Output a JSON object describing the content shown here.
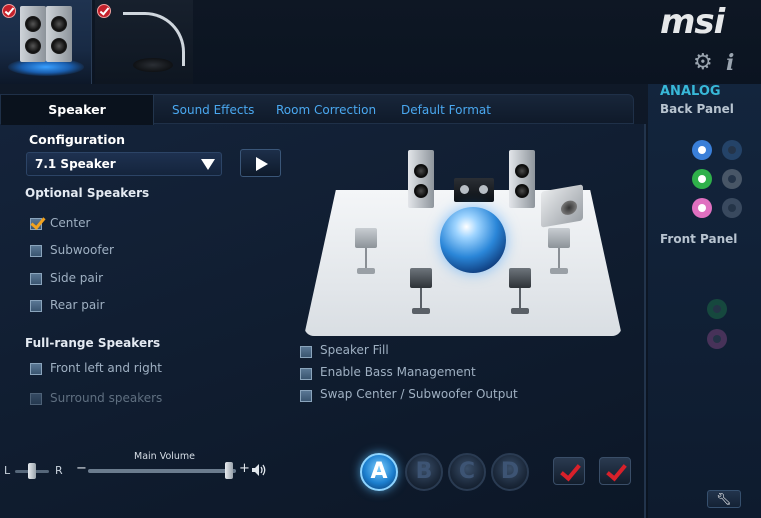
{
  "brand": {
    "logo_text": "msi"
  },
  "header": {
    "devices": [
      {
        "name": "Speakers",
        "icon": "speakers-icon",
        "selected": true,
        "enabled": true
      },
      {
        "name": "Microphone",
        "icon": "microphone-icon",
        "selected": false,
        "enabled": true
      }
    ],
    "settings_icon": "gear-icon",
    "info_icon": "info-icon",
    "info_glyph": "i"
  },
  "tabs": [
    {
      "label": "Speaker Configuration",
      "active": true
    },
    {
      "label": "Sound Effects",
      "active": false
    },
    {
      "label": "Room Correction",
      "active": false
    },
    {
      "label": "Default Format",
      "active": false
    }
  ],
  "config": {
    "selected": "7.1 Speaker"
  },
  "optional_speakers": {
    "title": "Optional Speakers",
    "items": [
      {
        "label": "Center",
        "checked": true,
        "enabled": true
      },
      {
        "label": "Subwoofer",
        "checked": false,
        "enabled": true
      },
      {
        "label": "Side pair",
        "checked": false,
        "enabled": true
      },
      {
        "label": "Rear pair",
        "checked": false,
        "enabled": true
      }
    ]
  },
  "full_range_speakers": {
    "title": "Full-range Speakers",
    "items": [
      {
        "label": "Front left and right",
        "checked": false,
        "enabled": true
      },
      {
        "label": "Surround speakers",
        "checked": false,
        "enabled": false
      }
    ]
  },
  "stage_options": [
    {
      "label": "Speaker Fill",
      "checked": false
    },
    {
      "label": "Enable Bass Management",
      "checked": false
    },
    {
      "label": "Swap Center / Subwoofer Output",
      "checked": false
    }
  ],
  "volume": {
    "label": "Main Volume",
    "balance_left": "L",
    "balance_right": "R",
    "balance_fraction": 0.5,
    "level_fraction": 0.95,
    "minus": "−",
    "plus": "+"
  },
  "profiles": [
    {
      "label": "A",
      "active": true
    },
    {
      "label": "B",
      "active": false
    },
    {
      "label": "C",
      "active": false
    },
    {
      "label": "D",
      "active": false
    }
  ],
  "right_panel": {
    "analog_label": "ANALOG",
    "back_panel_label": "Back Panel",
    "front_panel_label": "Front Panel",
    "jack_colors": {
      "blue": "#3a7fd8",
      "green": "#2fb04a",
      "pink": "#e070c0",
      "front_green": "#1e7a4a",
      "front_pink": "#8a4a86"
    }
  },
  "colors": {
    "accent": "#4aa8f0",
    "background": "#0c1522",
    "check": "#f1a21e",
    "action_red": "#d8202a"
  }
}
